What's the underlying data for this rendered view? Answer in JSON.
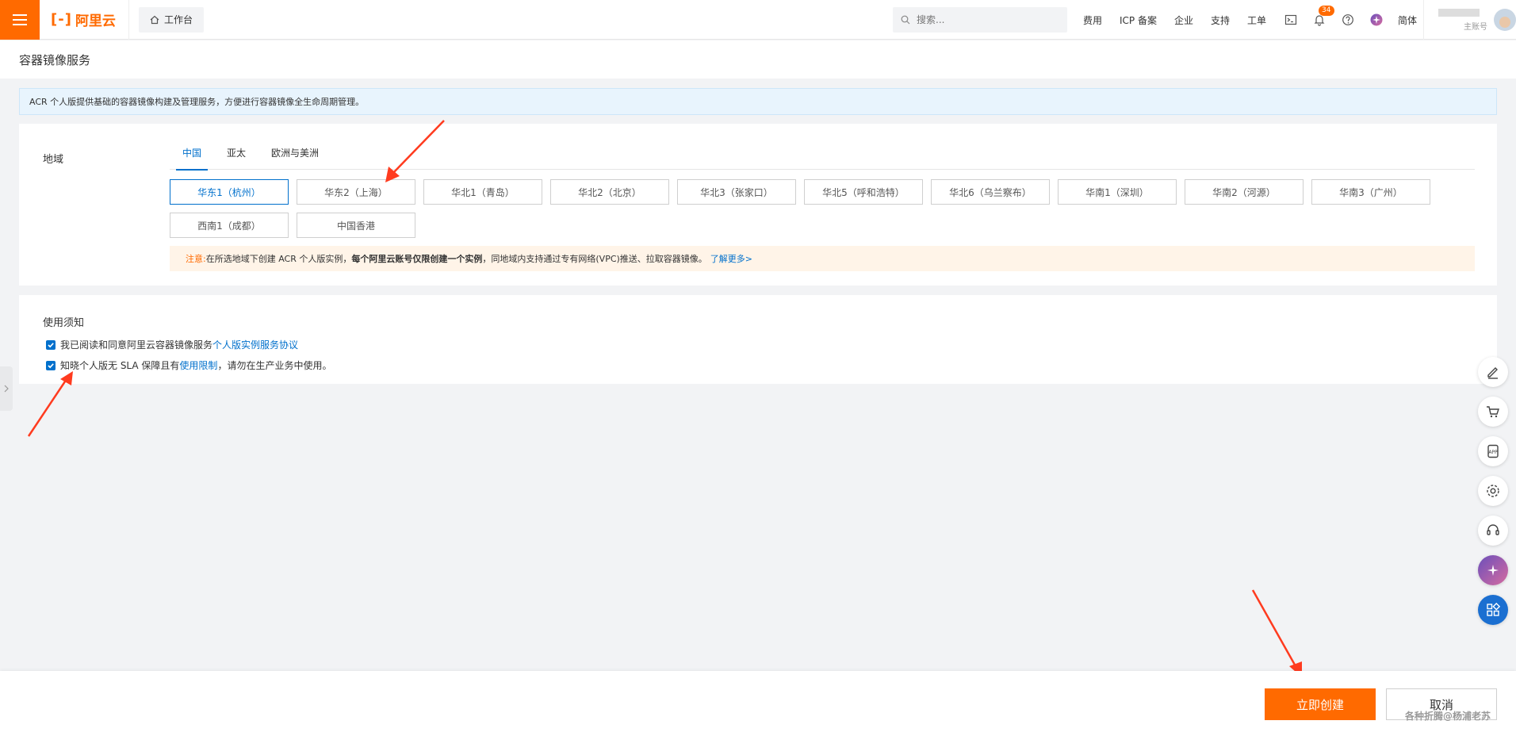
{
  "nav": {
    "logo_mark": "[-]",
    "logo_text": "阿里云",
    "workbench": "工作台",
    "search_placeholder": "搜索...",
    "links": [
      "费用",
      "ICP 备案",
      "企业",
      "支持",
      "工单"
    ],
    "notification_count": "34",
    "language": "简体",
    "account_sub": "主账号"
  },
  "page": {
    "title": "容器镜像服务",
    "info_banner": "ACR 个人版提供基础的容器镜像构建及管理服务，方便进行容器镜像全生命周期管理。"
  },
  "region": {
    "label": "地域",
    "tabs": [
      "中国",
      "亚太",
      "欧洲与美洲"
    ],
    "active_tab": "中国",
    "options": [
      "华东1（杭州）",
      "华东2（上海）",
      "华北1（青岛）",
      "华北2（北京）",
      "华北3（张家口）",
      "华北5（呼和浩特）",
      "华北6（乌兰察布）",
      "华南1（深圳）",
      "华南2（河源）",
      "华南3（广州）",
      "西南1（成都）",
      "中国香港"
    ],
    "selected": "华东1（杭州）",
    "notice_prefix": "注意:",
    "notice_text1": "在所选地域下创建 ACR 个人版实例，",
    "notice_bold": "每个阿里云账号仅限创建一个实例",
    "notice_text2": "，同地域内支持通过专有网络(VPC)推送、拉取容器镜像。",
    "notice_link": "了解更多>"
  },
  "terms": {
    "title": "使用须知",
    "item1_text": "我已阅读和同意阿里云容器镜像服务",
    "item1_link": "个人版实例服务协议",
    "item1_checked": true,
    "item2_text_a": "知晓个人版无 SLA 保障且有",
    "item2_link": "使用限制",
    "item2_text_b": "，请勿在生产业务中使用。",
    "item2_checked": true
  },
  "footer": {
    "create": "立即创建",
    "cancel": "取消",
    "watermark": "各种折腾@杨浦老苏"
  },
  "colors": {
    "brand": "#ff6a00",
    "link": "#0070cc",
    "info_bg": "#e8f4fd",
    "notice_bg": "#fff4e8",
    "arrow": "#ff3b1f"
  },
  "icons": {
    "menu": "hamburger-icon",
    "workbench": "home-icon",
    "search": "search-icon",
    "terminal": "terminal-icon",
    "bell": "bell-icon",
    "help": "help-icon",
    "float_tools": [
      "edit-icon",
      "cart-icon",
      "app-icon",
      "settings-icon",
      "headset-icon",
      "assistant-icon",
      "grid-icon"
    ]
  }
}
